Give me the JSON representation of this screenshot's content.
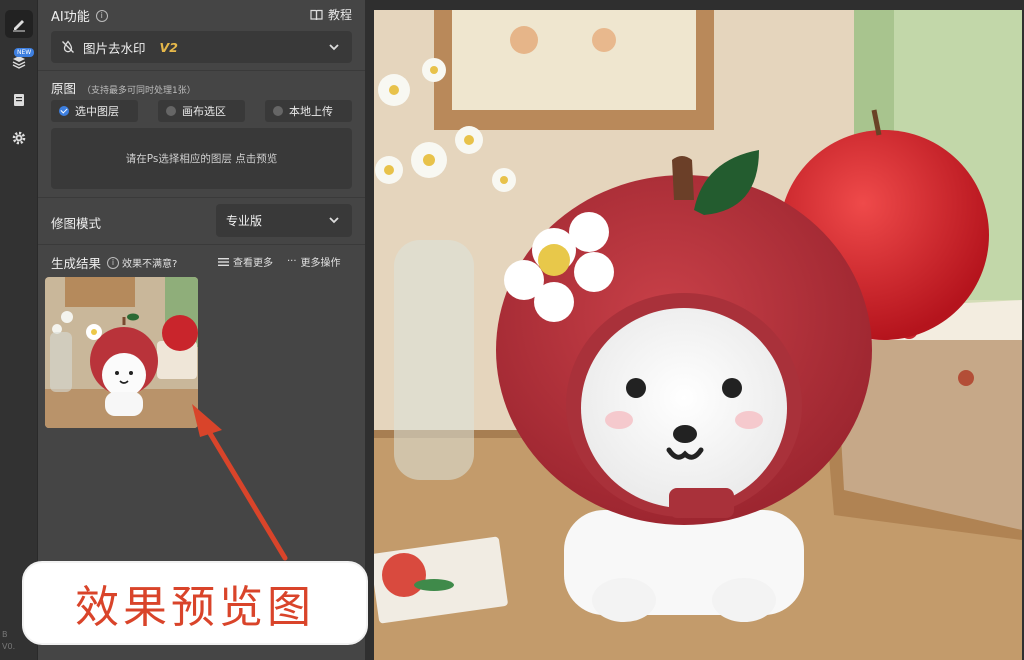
{
  "rail": {
    "new_badge": "NEW",
    "version": "B\nV0."
  },
  "header": {
    "title": "AI功能",
    "info_icon": "info-icon",
    "tutorial_label": "教程"
  },
  "function_select": {
    "label": "图片去水印",
    "version": "V2"
  },
  "source": {
    "title": "原图",
    "hint": "（支持最多可同时处理1张）",
    "options": [
      "选中图层",
      "画布选区",
      "本地上传"
    ],
    "selected_index": 0,
    "preview_placeholder": "请在Ps选择相应的图层 点击预览"
  },
  "mode": {
    "label": "修图模式",
    "value": "专业版"
  },
  "result": {
    "title": "生成结果",
    "hint": "效果不满意?",
    "view_more": "查看更多",
    "more_actions": "更多操作"
  },
  "annotation": {
    "text": "效果预览图"
  },
  "colors": {
    "accent": "#3d7fe0",
    "version_gold": "#e6b84a",
    "annotation_red": "#d9442a"
  }
}
